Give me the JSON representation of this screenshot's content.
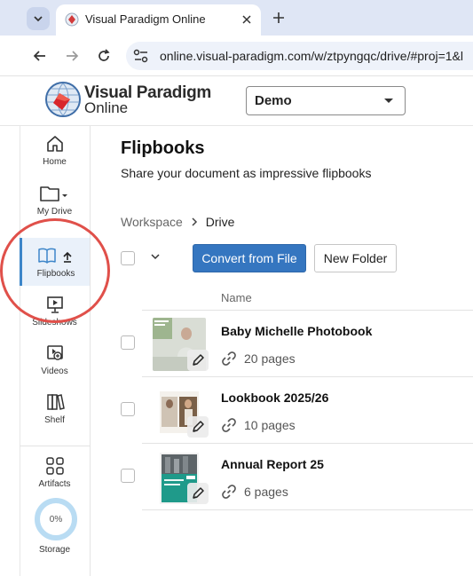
{
  "browser": {
    "tab_title": "Visual Paradigm Online",
    "url": "online.visual-paradigm.com/w/ztpyngqc/drive/#proj=1&l"
  },
  "header": {
    "logo_line1": "Visual Paradigm",
    "logo_line2": "Online",
    "workspace": "Demo"
  },
  "sidebar": {
    "items": [
      {
        "label": "Home",
        "icon": "home-icon"
      },
      {
        "label": "My Drive",
        "icon": "folder-icon"
      },
      {
        "label": "Flipbooks",
        "icon": "book-icon",
        "active": true
      },
      {
        "label": "Slideshows",
        "icon": "presentation-icon"
      },
      {
        "label": "Videos",
        "icon": "video-icon"
      },
      {
        "label": "Shelf",
        "icon": "shelf-icon"
      },
      {
        "label": "Artifacts",
        "icon": "grid-icon"
      }
    ],
    "storage_percent": "0%",
    "storage_label": "Storage"
  },
  "main": {
    "title": "Flipbooks",
    "subtitle": "Share your document as impressive flipbooks",
    "breadcrumb": {
      "workspace": "Workspace",
      "current": "Drive"
    },
    "convert_button": "Convert from File",
    "new_folder_button": "New Folder",
    "column_name": "Name",
    "rows": [
      {
        "name": "Baby Michelle Photobook",
        "pages": "20 pages"
      },
      {
        "name": "Lookbook 2025/26",
        "pages": "10 pages"
      },
      {
        "name": "Annual Report 25",
        "pages": "6 pages"
      }
    ]
  },
  "colors": {
    "accent": "#3576c0",
    "highlight": "#e0504a",
    "active_bg": "#eaf1fa"
  }
}
